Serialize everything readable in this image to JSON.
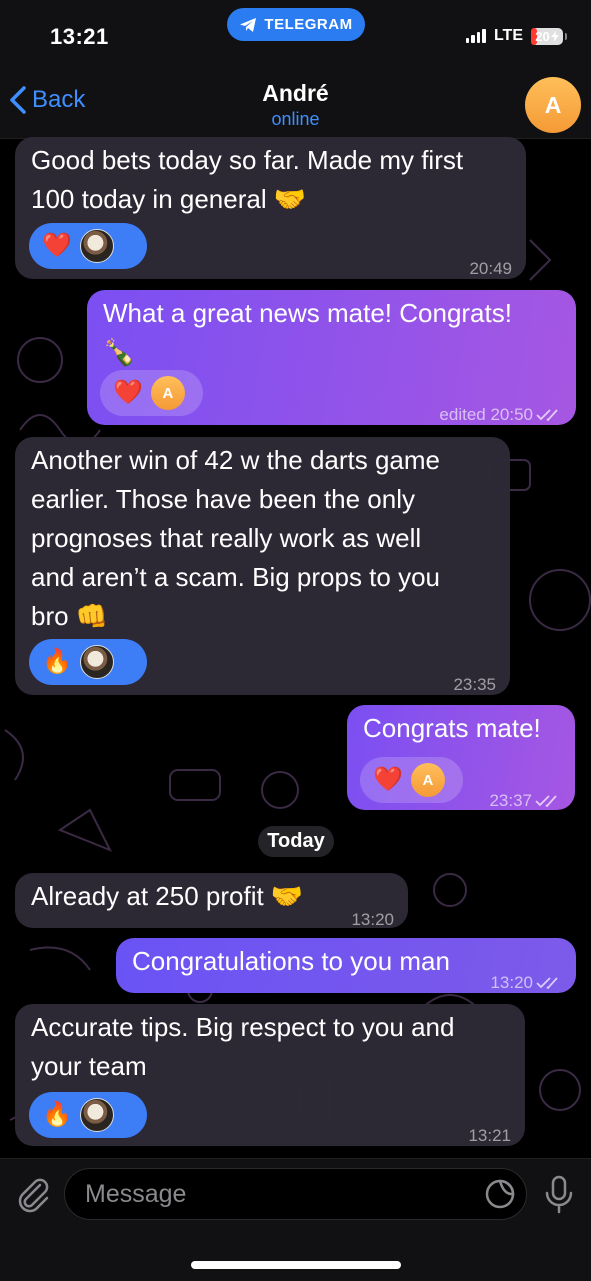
{
  "status_bar": {
    "time": "13:21",
    "app_pill": "TELEGRAM",
    "network": "LTE",
    "battery": "20",
    "battery_level": 0.2
  },
  "header": {
    "back_label": "Back",
    "name": "André",
    "status": "online",
    "avatar_letter": "A"
  },
  "messages": [
    {
      "text": "Good bets today so far. Made my first\n100 today in general 🤝",
      "time": "20:49",
      "reaction": "❤️"
    },
    {
      "text": "What a great news mate! Congrats!\n🍾",
      "time": "edited 20:50",
      "reaction": "❤️",
      "reactor": "A"
    },
    {
      "text": "Another win of 42 w the darts game\nearlier. Those have been the only\nprognoses that really work as well\nand aren’t a scam.  Big props to you\nbro 👊",
      "time": "23:35",
      "reaction": "🔥"
    },
    {
      "text": "Congrats mate!",
      "time": "23:37",
      "reaction": "❤️",
      "reactor": "A"
    },
    {
      "text": "Already at 250 profit 🤝",
      "time": "13:20"
    },
    {
      "text": "Congratulations to you man",
      "time": "13:20"
    },
    {
      "text": "Accurate tips. Big respect to you and\nyour team",
      "time": "13:21",
      "reaction": "🔥"
    }
  ],
  "day_separator": "Today",
  "composer": {
    "placeholder": "Message"
  },
  "icons": [
    "telegram-icon",
    "signal-icon",
    "battery-icon",
    "chevron-left-icon",
    "paperclip-icon",
    "sticker-icon",
    "microphone-icon",
    "double-check-icon"
  ],
  "colors": {
    "accent": "#3e8fff",
    "outgoing_bubble": "#8b53ee",
    "incoming_bubble": "#2e2a36",
    "reaction_pill": "#3d7df5",
    "avatar": "#f7a940"
  }
}
